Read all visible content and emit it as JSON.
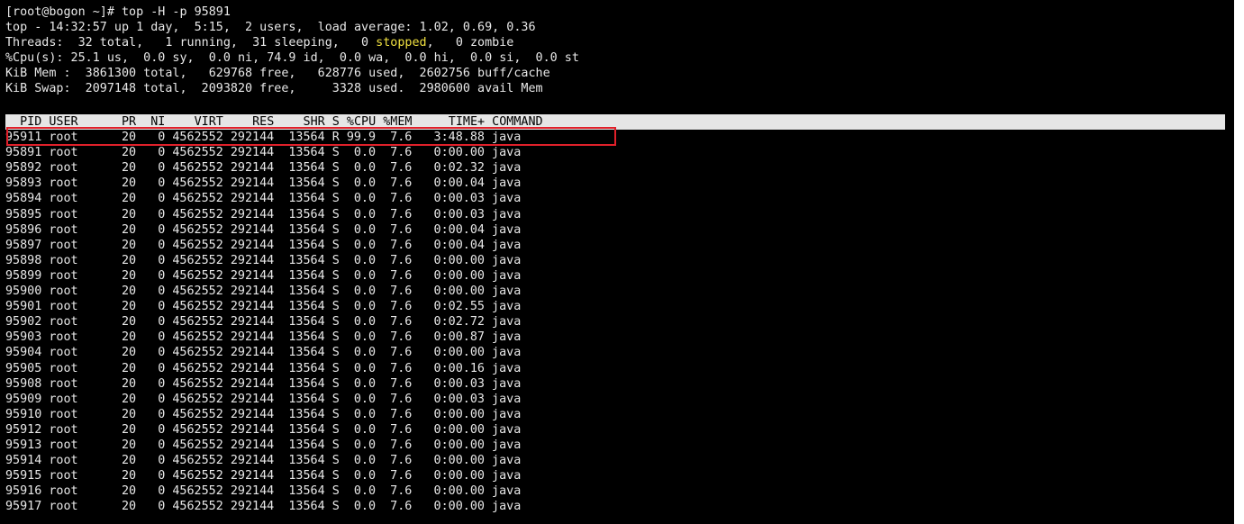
{
  "session": {
    "prompt_line": "[root@bogon ~]# top -H -p 95891",
    "summary": {
      "uptime_line": "top - 14:32:57 up 1 day,  5:15,  2 users,  load average: 1.02, 0.69, 0.36",
      "threads_before": "Threads:  32 total,   1 running,  31 sleeping,   0 ",
      "threads_stopped": "stopped",
      "threads_after": ",   0 zombie",
      "cpu_line": "%Cpu(s): 25.1 us,  0.0 sy,  0.0 ni, 74.9 id,  0.0 wa,  0.0 hi,  0.0 si,  0.0 st",
      "mem_line": "KiB Mem :  3861300 total,   629768 free,   628776 used,  2602756 buff/cache",
      "swap_line": "KiB Swap:  2097148 total,  2093820 free,     3328 used.  2980600 avail Mem"
    },
    "table_header": "  PID USER      PR  NI    VIRT    RES    SHR S %CPU %MEM     TIME+ COMMAND",
    "rows": [
      {
        "pid": "95911",
        "user": "root",
        "pr": "20",
        "ni": "0",
        "virt": "4562552",
        "res": "292144",
        "shr": "13564",
        "s": "R",
        "cpu": "99.9",
        "mem": "7.6",
        "time": "3:48.88",
        "cmd": "java"
      },
      {
        "pid": "95891",
        "user": "root",
        "pr": "20",
        "ni": "0",
        "virt": "4562552",
        "res": "292144",
        "shr": "13564",
        "s": "S",
        "cpu": "0.0",
        "mem": "7.6",
        "time": "0:00.00",
        "cmd": "java"
      },
      {
        "pid": "95892",
        "user": "root",
        "pr": "20",
        "ni": "0",
        "virt": "4562552",
        "res": "292144",
        "shr": "13564",
        "s": "S",
        "cpu": "0.0",
        "mem": "7.6",
        "time": "0:02.32",
        "cmd": "java"
      },
      {
        "pid": "95893",
        "user": "root",
        "pr": "20",
        "ni": "0",
        "virt": "4562552",
        "res": "292144",
        "shr": "13564",
        "s": "S",
        "cpu": "0.0",
        "mem": "7.6",
        "time": "0:00.04",
        "cmd": "java"
      },
      {
        "pid": "95894",
        "user": "root",
        "pr": "20",
        "ni": "0",
        "virt": "4562552",
        "res": "292144",
        "shr": "13564",
        "s": "S",
        "cpu": "0.0",
        "mem": "7.6",
        "time": "0:00.03",
        "cmd": "java"
      },
      {
        "pid": "95895",
        "user": "root",
        "pr": "20",
        "ni": "0",
        "virt": "4562552",
        "res": "292144",
        "shr": "13564",
        "s": "S",
        "cpu": "0.0",
        "mem": "7.6",
        "time": "0:00.03",
        "cmd": "java"
      },
      {
        "pid": "95896",
        "user": "root",
        "pr": "20",
        "ni": "0",
        "virt": "4562552",
        "res": "292144",
        "shr": "13564",
        "s": "S",
        "cpu": "0.0",
        "mem": "7.6",
        "time": "0:00.04",
        "cmd": "java"
      },
      {
        "pid": "95897",
        "user": "root",
        "pr": "20",
        "ni": "0",
        "virt": "4562552",
        "res": "292144",
        "shr": "13564",
        "s": "S",
        "cpu": "0.0",
        "mem": "7.6",
        "time": "0:00.04",
        "cmd": "java"
      },
      {
        "pid": "95898",
        "user": "root",
        "pr": "20",
        "ni": "0",
        "virt": "4562552",
        "res": "292144",
        "shr": "13564",
        "s": "S",
        "cpu": "0.0",
        "mem": "7.6",
        "time": "0:00.00",
        "cmd": "java"
      },
      {
        "pid": "95899",
        "user": "root",
        "pr": "20",
        "ni": "0",
        "virt": "4562552",
        "res": "292144",
        "shr": "13564",
        "s": "S",
        "cpu": "0.0",
        "mem": "7.6",
        "time": "0:00.00",
        "cmd": "java"
      },
      {
        "pid": "95900",
        "user": "root",
        "pr": "20",
        "ni": "0",
        "virt": "4562552",
        "res": "292144",
        "shr": "13564",
        "s": "S",
        "cpu": "0.0",
        "mem": "7.6",
        "time": "0:00.00",
        "cmd": "java"
      },
      {
        "pid": "95901",
        "user": "root",
        "pr": "20",
        "ni": "0",
        "virt": "4562552",
        "res": "292144",
        "shr": "13564",
        "s": "S",
        "cpu": "0.0",
        "mem": "7.6",
        "time": "0:02.55",
        "cmd": "java"
      },
      {
        "pid": "95902",
        "user": "root",
        "pr": "20",
        "ni": "0",
        "virt": "4562552",
        "res": "292144",
        "shr": "13564",
        "s": "S",
        "cpu": "0.0",
        "mem": "7.6",
        "time": "0:02.72",
        "cmd": "java"
      },
      {
        "pid": "95903",
        "user": "root",
        "pr": "20",
        "ni": "0",
        "virt": "4562552",
        "res": "292144",
        "shr": "13564",
        "s": "S",
        "cpu": "0.0",
        "mem": "7.6",
        "time": "0:00.87",
        "cmd": "java"
      },
      {
        "pid": "95904",
        "user": "root",
        "pr": "20",
        "ni": "0",
        "virt": "4562552",
        "res": "292144",
        "shr": "13564",
        "s": "S",
        "cpu": "0.0",
        "mem": "7.6",
        "time": "0:00.00",
        "cmd": "java"
      },
      {
        "pid": "95905",
        "user": "root",
        "pr": "20",
        "ni": "0",
        "virt": "4562552",
        "res": "292144",
        "shr": "13564",
        "s": "S",
        "cpu": "0.0",
        "mem": "7.6",
        "time": "0:00.16",
        "cmd": "java"
      },
      {
        "pid": "95908",
        "user": "root",
        "pr": "20",
        "ni": "0",
        "virt": "4562552",
        "res": "292144",
        "shr": "13564",
        "s": "S",
        "cpu": "0.0",
        "mem": "7.6",
        "time": "0:00.03",
        "cmd": "java"
      },
      {
        "pid": "95909",
        "user": "root",
        "pr": "20",
        "ni": "0",
        "virt": "4562552",
        "res": "292144",
        "shr": "13564",
        "s": "S",
        "cpu": "0.0",
        "mem": "7.6",
        "time": "0:00.03",
        "cmd": "java"
      },
      {
        "pid": "95910",
        "user": "root",
        "pr": "20",
        "ni": "0",
        "virt": "4562552",
        "res": "292144",
        "shr": "13564",
        "s": "S",
        "cpu": "0.0",
        "mem": "7.6",
        "time": "0:00.00",
        "cmd": "java"
      },
      {
        "pid": "95912",
        "user": "root",
        "pr": "20",
        "ni": "0",
        "virt": "4562552",
        "res": "292144",
        "shr": "13564",
        "s": "S",
        "cpu": "0.0",
        "mem": "7.6",
        "time": "0:00.00",
        "cmd": "java"
      },
      {
        "pid": "95913",
        "user": "root",
        "pr": "20",
        "ni": "0",
        "virt": "4562552",
        "res": "292144",
        "shr": "13564",
        "s": "S",
        "cpu": "0.0",
        "mem": "7.6",
        "time": "0:00.00",
        "cmd": "java"
      },
      {
        "pid": "95914",
        "user": "root",
        "pr": "20",
        "ni": "0",
        "virt": "4562552",
        "res": "292144",
        "shr": "13564",
        "s": "S",
        "cpu": "0.0",
        "mem": "7.6",
        "time": "0:00.00",
        "cmd": "java"
      },
      {
        "pid": "95915",
        "user": "root",
        "pr": "20",
        "ni": "0",
        "virt": "4562552",
        "res": "292144",
        "shr": "13564",
        "s": "S",
        "cpu": "0.0",
        "mem": "7.6",
        "time": "0:00.00",
        "cmd": "java"
      },
      {
        "pid": "95916",
        "user": "root",
        "pr": "20",
        "ni": "0",
        "virt": "4562552",
        "res": "292144",
        "shr": "13564",
        "s": "S",
        "cpu": "0.0",
        "mem": "7.6",
        "time": "0:00.00",
        "cmd": "java"
      },
      {
        "pid": "95917",
        "user": "root",
        "pr": "20",
        "ni": "0",
        "virt": "4562552",
        "res": "292144",
        "shr": "13564",
        "s": "S",
        "cpu": "0.0",
        "mem": "7.6",
        "time": "0:00.00",
        "cmd": "java"
      }
    ]
  },
  "colors": {
    "background": "#000000",
    "text": "#e8e8e8",
    "header_bg": "#e6e6e6",
    "stopped": "#f0e040",
    "highlight_box": "#e0202a"
  }
}
